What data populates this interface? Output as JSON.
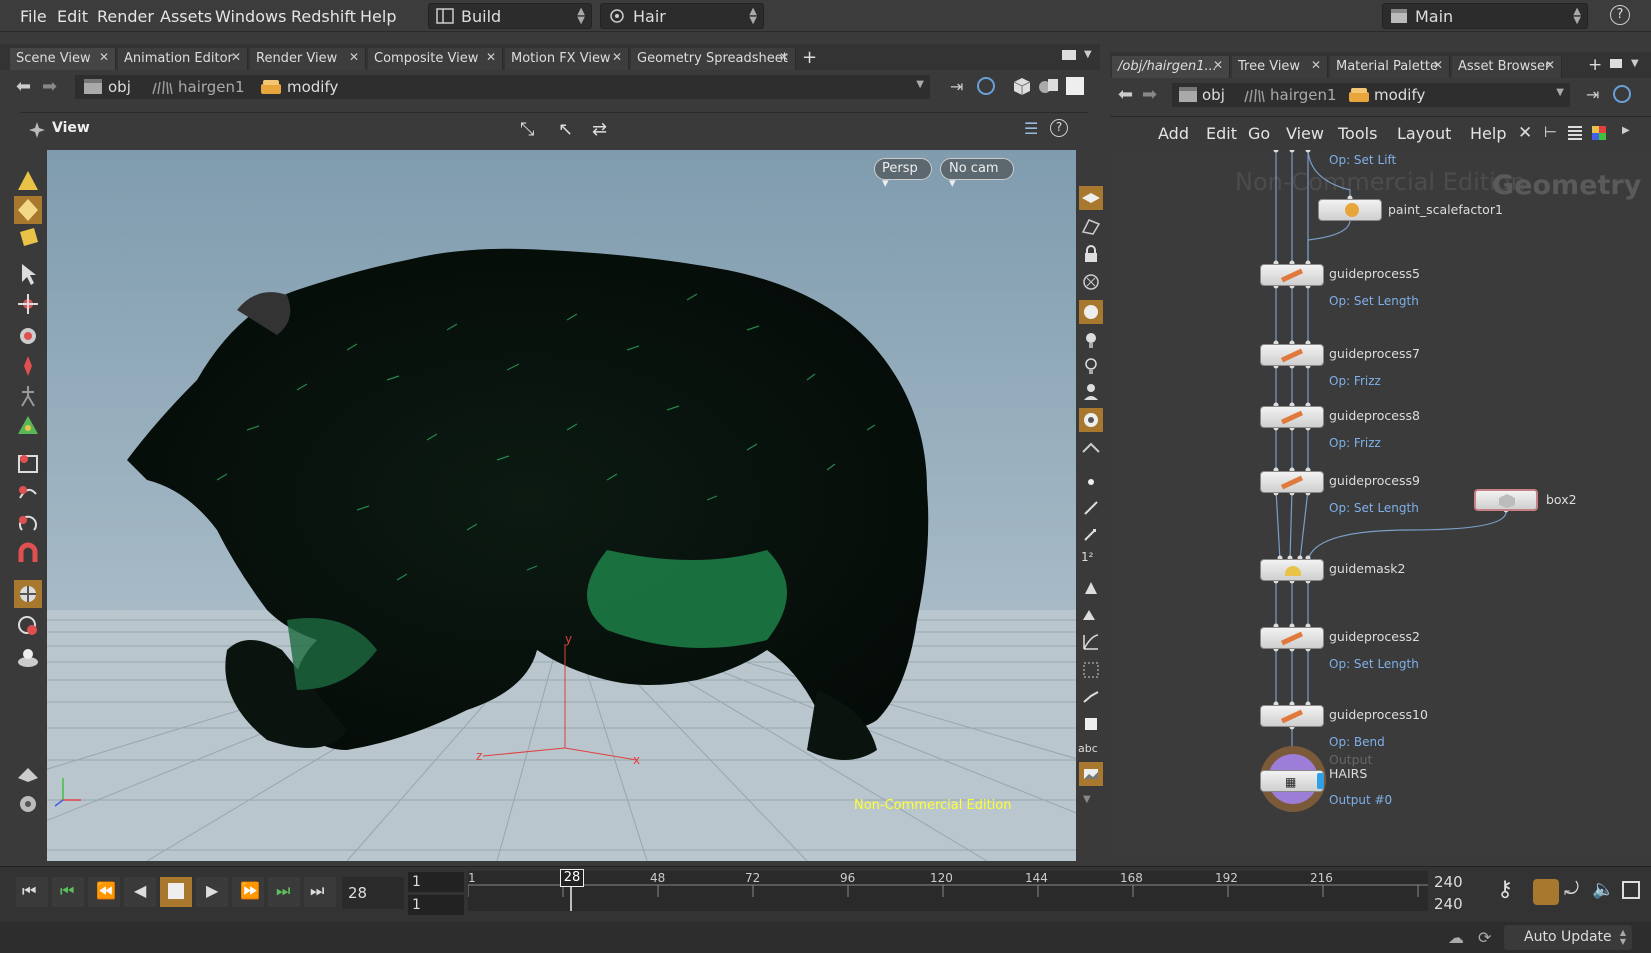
{
  "menu": {
    "items": [
      "File",
      "Edit",
      "Render",
      "Assets",
      "Windows",
      "Redshift",
      "Help"
    ],
    "desktop": "Build",
    "shelf": "Hair",
    "context": "Main"
  },
  "left_tabs": [
    "Scene View",
    "Animation Editor",
    "Render View",
    "Composite View",
    "Motion FX View",
    "Geometry Spreadsheet"
  ],
  "right_tabs": [
    "/obj/hairgen1...",
    "Tree View",
    "Material Palette",
    "Asset Browser"
  ],
  "path": {
    "root": "obj",
    "node": "hairgen1",
    "sop": "modify"
  },
  "viewer": {
    "title": "View",
    "persp": "Persp",
    "cam": "No cam",
    "watermark": "Non-Commercial Edition",
    "axis_y": "y",
    "axis_x": "x",
    "axis_z": "z"
  },
  "network": {
    "menus": [
      "Add",
      "Edit",
      "Go",
      "View",
      "Tools",
      "Layout",
      "Help"
    ],
    "watermark": "Non-Commercial Edition",
    "context_label": "Geometry",
    "top_op": "Op: Set Lift",
    "nodes": [
      {
        "name": "paint_scalefactor1",
        "op": ""
      },
      {
        "name": "guideprocess5",
        "op": "Op: Set Length"
      },
      {
        "name": "guideprocess7",
        "op": "Op: Frizz"
      },
      {
        "name": "guideprocess8",
        "op": "Op: Frizz"
      },
      {
        "name": "guideprocess9",
        "op": "Op: Set Length"
      },
      {
        "name": "box2",
        "op": ""
      },
      {
        "name": "guidemask2",
        "op": ""
      },
      {
        "name": "guideprocess2",
        "op": "Op: Set Length"
      },
      {
        "name": "guideprocess10",
        "op": "Op: Bend"
      }
    ],
    "output": {
      "label": "Output",
      "name": "HAIRS",
      "op": "Output #0"
    },
    "right_icons": [
      "abc"
    ]
  },
  "timeline": {
    "current_frame": "28",
    "start": "1",
    "start2": "1",
    "end": "240",
    "end2": "240",
    "ticks": [
      "1",
      "48",
      "72",
      "96",
      "120",
      "144",
      "168",
      "192",
      "216"
    ],
    "marker": "28"
  },
  "status": {
    "auto_update": "Auto Update"
  },
  "colors": {
    "accent": "#e8a53c",
    "op_text": "#7fb0e8",
    "watermark_yellow": "#ffff33"
  }
}
